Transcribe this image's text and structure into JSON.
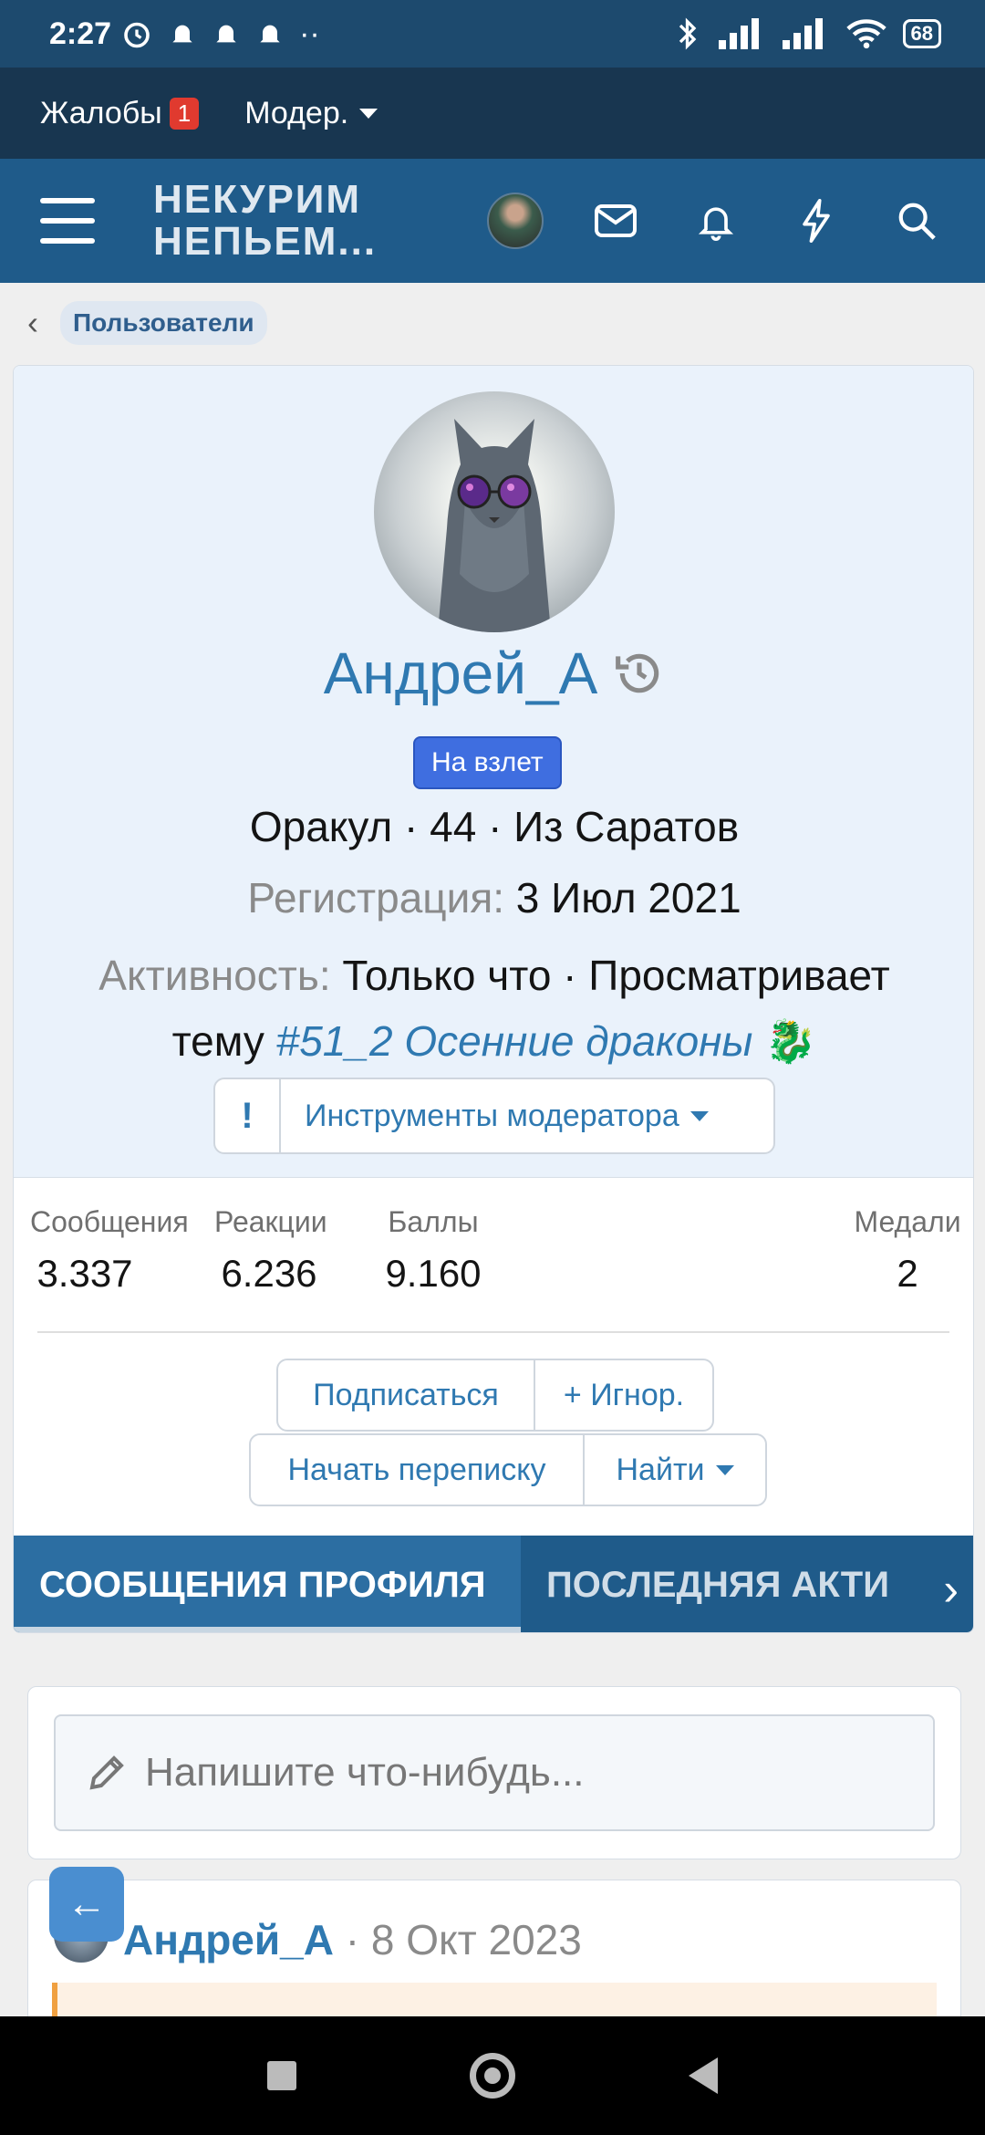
{
  "status_bar": {
    "time": "2:27",
    "battery": "68"
  },
  "mod_bar": {
    "complaints_label": "Жалобы",
    "complaints_count": "1",
    "moder_label": "Модер."
  },
  "header": {
    "logo_line1": "НЕКУРИМ",
    "logo_line2": "НЕПЬЕМ..."
  },
  "breadcrumb": {
    "label": "Пользователи"
  },
  "profile": {
    "username": "Андрей_А",
    "rank": "На взлет",
    "title_line": "Оракул · 44 · Из Саратов",
    "registration_label": "Регистрация:",
    "registration_date": "3 Июл 2021",
    "activity_label": "Активность:",
    "activity_text": "Только что · Просматривает",
    "activity_text2": "тему",
    "activity_link": "#51_2 Осенние драконы",
    "activity_emoji": "🐉",
    "mod_tools_icon": "!",
    "mod_tools_label": "Инструменты модератора"
  },
  "stats": [
    {
      "label": "Сообщения",
      "value": "3.337"
    },
    {
      "label": "Реакции",
      "value": "6.236"
    },
    {
      "label": "Баллы",
      "value": "9.160"
    },
    {
      "label": "Медали",
      "value": "2"
    }
  ],
  "actions": {
    "follow": "Подписаться",
    "ignore": "+ Игнор.",
    "start_conversation": "Начать переписку",
    "find": "Найти"
  },
  "tabs": [
    {
      "label": "СООБЩЕНИЯ ПРОФИЛЯ",
      "active": true
    },
    {
      "label": "ПОСЛЕДНЯЯ АКТИ",
      "active": false
    }
  ],
  "composer": {
    "placeholder": "Напишите что-нибудь..."
  },
  "post": {
    "author": "Андрей_А",
    "date": "· 8 Окт 2023"
  },
  "colors": {
    "header": "#1f5b8a",
    "link": "#2f79b1",
    "rank_badge": "#3f6ee0",
    "alert": "#e03a2f"
  }
}
